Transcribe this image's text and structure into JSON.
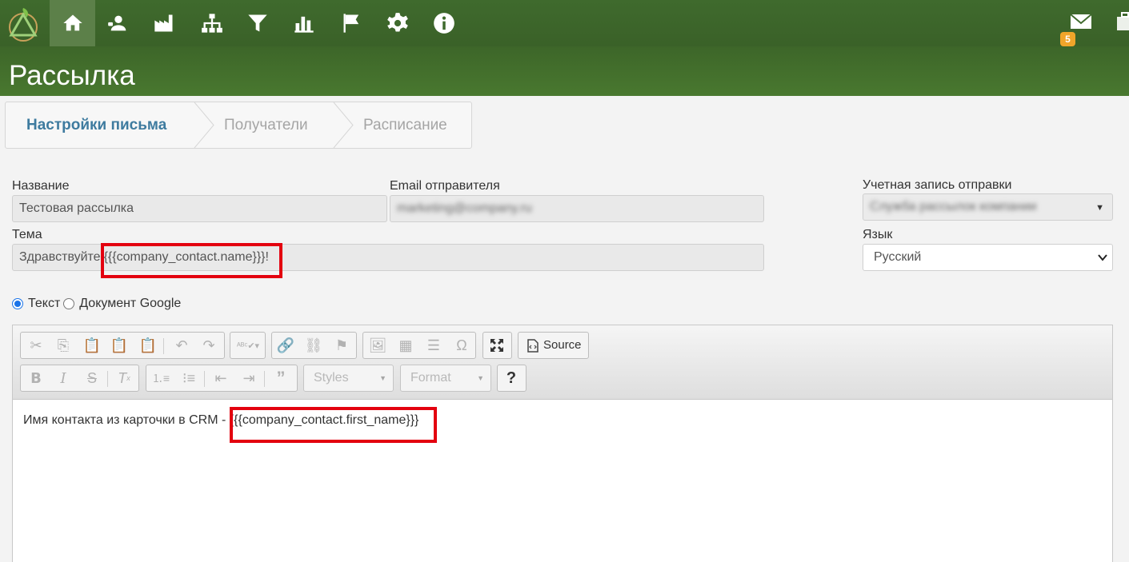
{
  "nav": {
    "items": [
      "home-icon",
      "contacts-icon",
      "companies-icon",
      "structure-icon",
      "filter-icon",
      "reports-icon",
      "flag-icon",
      "settings-icon",
      "info-icon"
    ],
    "active": "home-icon",
    "mail_badge": "5"
  },
  "page": {
    "title": "Рассылка"
  },
  "wizard": {
    "steps": [
      "Настройки письма",
      "Получатели",
      "Расписание"
    ],
    "active": 0
  },
  "form": {
    "name_label": "Название",
    "name_value": "Тестовая рассылка",
    "email_label": "Email отправителя",
    "email_value": "marketing@company.ru",
    "account_label": "Учетная запись отправки",
    "account_value": "Служба рассылок компании",
    "subject_label": "Тема",
    "subject_prefix": "Здравствуйте",
    "subject_var": "{{{company_contact.name}}}",
    "subject_suffix": "!",
    "language_label": "Язык",
    "language_value": "Русский"
  },
  "content_type": {
    "options": [
      "Текст",
      "Документ Google"
    ],
    "selected": "Текст"
  },
  "editor": {
    "source_label": "Source",
    "styles_placeholder": "Styles",
    "format_placeholder": "Format",
    "help_label": "?",
    "body_text": "Имя контакта из карточки в CRM - ",
    "body_var": "{{{company_contact.first_name}}}"
  },
  "colors": {
    "highlight": "#e3000f",
    "nav_bg": "#3f6a2d",
    "active_step": "#3e7b9f"
  }
}
